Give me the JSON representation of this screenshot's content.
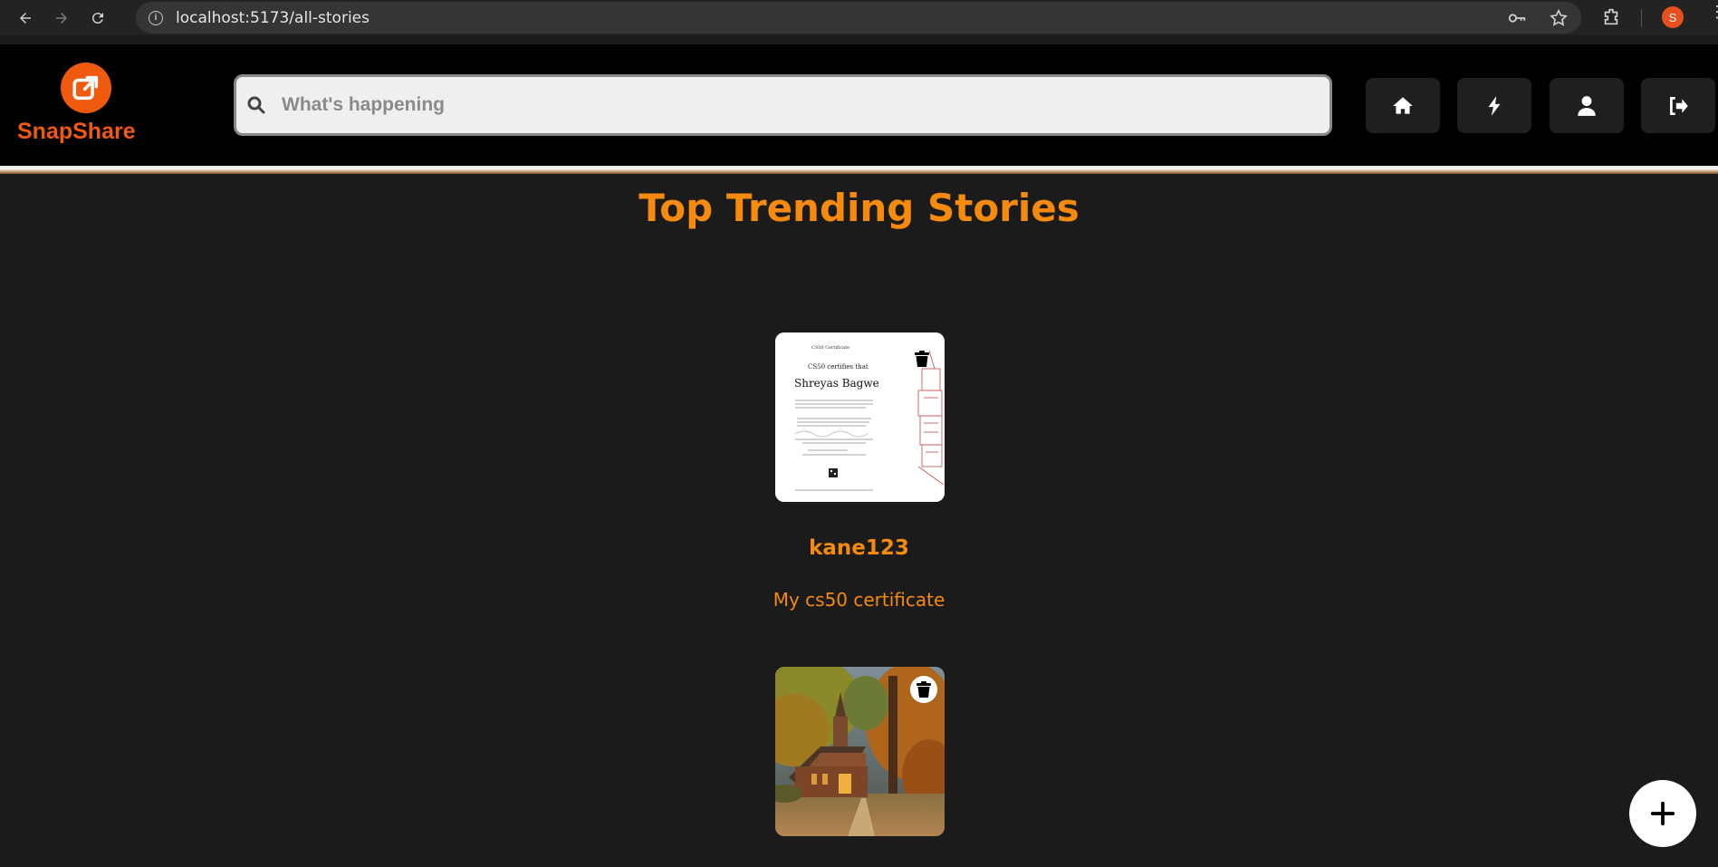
{
  "browser": {
    "url": "localhost:5173/all-stories",
    "profile_initial": "S"
  },
  "app": {
    "logo_text": "SnapShare",
    "brand_color": "#f05a0f",
    "search_placeholder": "What's happening",
    "nav": [
      {
        "name": "home",
        "icon": "home-icon"
      },
      {
        "name": "bolt",
        "icon": "bolt-icon"
      },
      {
        "name": "profile",
        "icon": "user-icon"
      },
      {
        "name": "logout",
        "icon": "logout-icon"
      }
    ]
  },
  "main": {
    "title": "Top Trending Stories",
    "accent_color": "#f58a0c",
    "stories": [
      {
        "username": "kane123",
        "caption": "My cs50 certificate",
        "certificate": {
          "header_small": "CS50 Certificate",
          "line1": "CS50 certifies that",
          "name": "Shreyas Bagwe"
        }
      },
      {
        "username": "",
        "caption": "",
        "image": "chapel-in-autumn-forest"
      }
    ]
  }
}
